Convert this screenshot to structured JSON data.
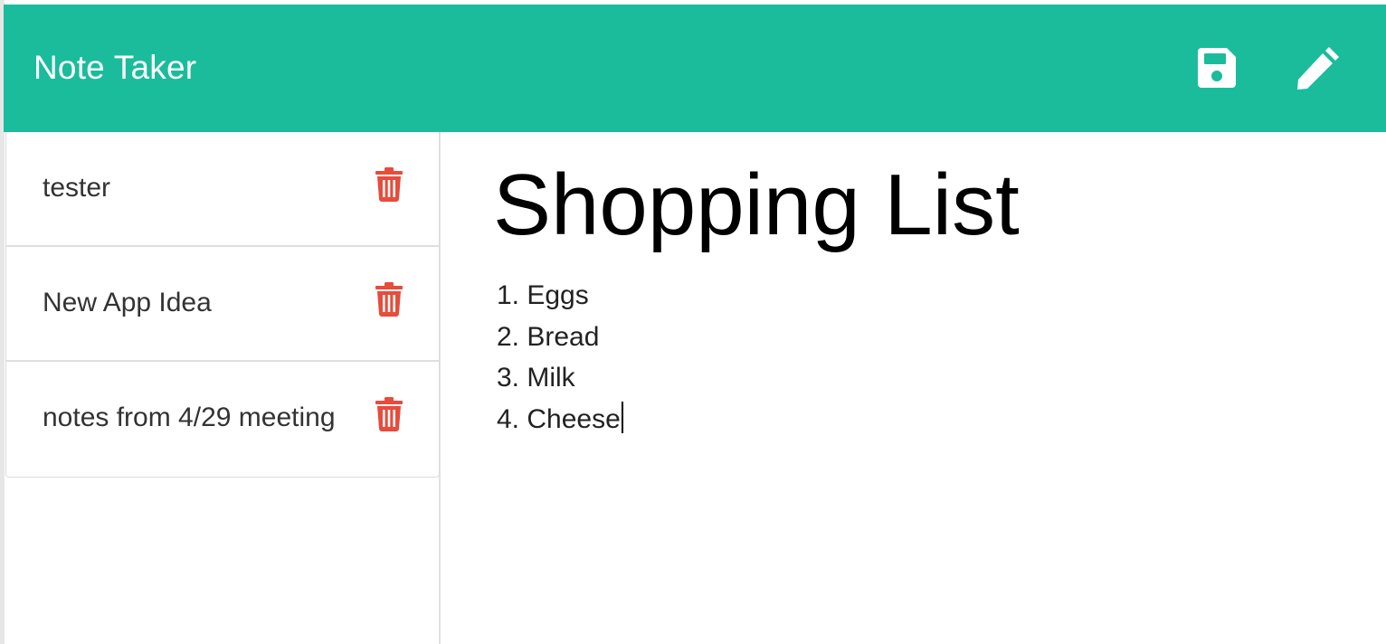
{
  "header": {
    "title": "Note Taker",
    "icons": {
      "save": "save-icon",
      "edit": "pencil-icon"
    }
  },
  "colors": {
    "header_bg": "#1abc9c",
    "header_text": "#ffffff",
    "delete_icon": "#e74c3c"
  },
  "sidebar": {
    "notes": [
      {
        "title": "tester",
        "icon": "trash-icon"
      },
      {
        "title": "New App Idea",
        "icon": "trash-icon"
      },
      {
        "title": "notes from 4/29 meeting",
        "icon": "trash-icon"
      }
    ]
  },
  "editor": {
    "title": "Shopping List",
    "lines": [
      "1. Eggs",
      "2. Bread",
      "3. Milk",
      "4. Cheese"
    ]
  }
}
